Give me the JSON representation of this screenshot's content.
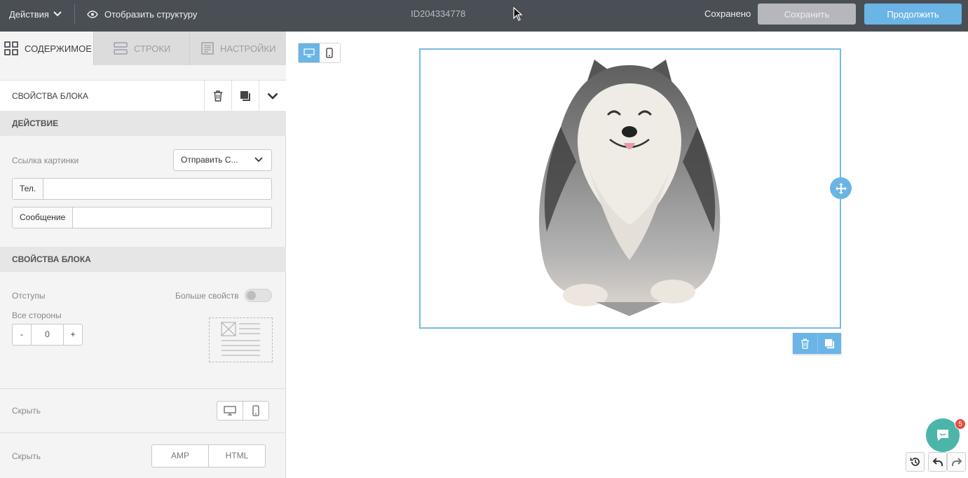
{
  "topbar": {
    "actions_label": "Действия",
    "structure_label": "Отобразить структуру",
    "page_id": "ID204334778",
    "saved_status": "Сохранено",
    "save_button": "Сохранить",
    "continue_button": "Продолжить"
  },
  "sidebar": {
    "tabs": [
      {
        "label": "Содержимое",
        "icon": "grid-icon",
        "active": true
      },
      {
        "label": "Строки",
        "icon": "rows-icon",
        "active": false
      },
      {
        "label": "Настройки",
        "icon": "settings-doc-icon",
        "active": false
      }
    ],
    "block_props_title": "Свойства блока",
    "action_section": "Действие",
    "image_link_label": "Ссылка картинки",
    "image_link_value": "Отправить С...",
    "phone_prefix": "Тел.",
    "phone_value": "",
    "message_prefix": "Сообщение",
    "message_value": "",
    "block_props_section": "Свойства блока",
    "padding_label": "Отступы",
    "more_props_label": "Больше свойств",
    "all_sides_label": "Все стороны",
    "stepper": {
      "minus": "-",
      "value": "0",
      "plus": "+"
    },
    "hide_devices_label": "Скрыть",
    "hide_format_label": "Скрыть",
    "format_options": [
      "AMP",
      "HTML"
    ]
  },
  "canvas": {
    "chat_badge": "5"
  },
  "colors": {
    "topbar": "#4a4f55",
    "accent": "#6ab4e6",
    "chat": "#4cb5aa",
    "badge": "#e84a3c"
  }
}
